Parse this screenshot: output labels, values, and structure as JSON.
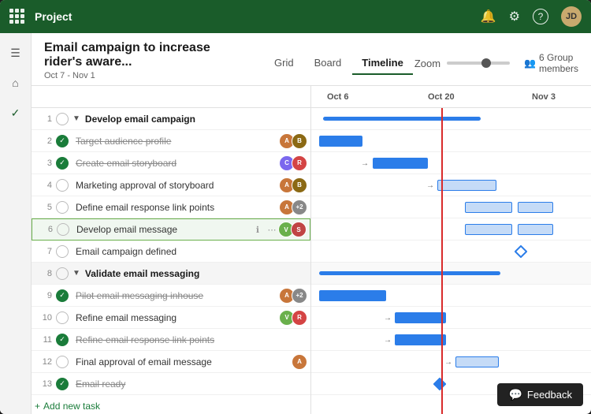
{
  "titlebar": {
    "app_name": "Project",
    "icons": {
      "bell": "🔔",
      "gear": "⚙",
      "help": "?",
      "avatar_initials": "JD"
    }
  },
  "header": {
    "project_title": "Email campaign to increase rider's aware...",
    "date_range": "Oct 7 - Nov 1",
    "tabs": [
      "Grid",
      "Board",
      "Timeline"
    ],
    "active_tab": "Timeline",
    "zoom_label": "Zoom",
    "group_members": "6 Group members"
  },
  "dates": {
    "oct6": "Oct 6",
    "oct20": "Oct 20",
    "nov3": "Nov 3"
  },
  "tasks": [
    {
      "id": 1,
      "num": "1",
      "done": false,
      "is_group": true,
      "name": "Develop email campaign",
      "expanded": true,
      "avatars": []
    },
    {
      "id": 2,
      "num": "2",
      "done": true,
      "is_group": false,
      "name": "Target audience profile",
      "strikethrough": true,
      "avatars": [
        {
          "color": "#c8763a",
          "initials": "A"
        },
        {
          "color": "#8b4513",
          "initials": "B"
        }
      ]
    },
    {
      "id": 3,
      "num": "3",
      "done": true,
      "is_group": false,
      "name": "Create email storyboard",
      "strikethrough": true,
      "avatars": [
        {
          "color": "#7b68ee",
          "initials": "C"
        },
        {
          "color": "#d44"
        },
        "R"
      ]
    },
    {
      "id": 4,
      "num": "4",
      "done": false,
      "is_group": false,
      "name": "Marketing approval of storyboard",
      "avatars": [
        {
          "color": "#c8763a",
          "initials": "A"
        },
        {
          "color": "#8b4513",
          "initials": "B"
        }
      ]
    },
    {
      "id": 5,
      "num": "5",
      "done": false,
      "is_group": false,
      "name": "Define email response link points",
      "avatars": [
        {
          "color": "#c8763a",
          "initials": "A"
        },
        {
          "color": "#888",
          "initials": "+2"
        }
      ]
    },
    {
      "id": 6,
      "num": "6",
      "done": false,
      "is_group": false,
      "name": "Develop email message",
      "highlighted": true,
      "avatars": [
        {
          "color": "#6ab04c",
          "initials": "V"
        },
        {
          "color": "#c04",
          "initials": "S"
        }
      ]
    },
    {
      "id": 7,
      "num": "7",
      "done": false,
      "is_group": false,
      "name": "Email campaign defined",
      "avatars": []
    },
    {
      "id": 8,
      "num": "8",
      "done": false,
      "is_group": true,
      "name": "Validate email messaging",
      "expanded": true,
      "avatars": []
    },
    {
      "id": 9,
      "num": "9",
      "done": true,
      "is_group": false,
      "name": "Pilot email messaging inhouse",
      "strikethrough": true,
      "avatars": [
        {
          "color": "#c8763a",
          "initials": "A"
        },
        {
          "color": "#888",
          "initials": "+2"
        }
      ]
    },
    {
      "id": 10,
      "num": "10",
      "done": false,
      "is_group": false,
      "name": "Refine email messaging",
      "avatars": [
        {
          "color": "#6ab04c",
          "initials": "V"
        },
        {
          "color": "#d44",
          "initials": "R"
        }
      ]
    },
    {
      "id": 11,
      "num": "11",
      "done": true,
      "is_group": false,
      "name": "Refine email response link points",
      "strikethrough": true,
      "avatars": []
    },
    {
      "id": 12,
      "num": "12",
      "done": false,
      "is_group": false,
      "name": "Final approval of email message",
      "avatars": [
        {
          "color": "#c8763a",
          "initials": "A"
        }
      ]
    },
    {
      "id": 13,
      "num": "13",
      "done": true,
      "is_group": false,
      "name": "Email ready",
      "strikethrough": true,
      "avatars": []
    }
  ],
  "add_task_label": "Add new task",
  "feedback_label": "Feedback"
}
